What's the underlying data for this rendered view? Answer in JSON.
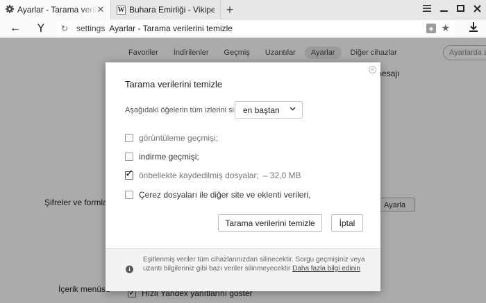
{
  "browser": {
    "tabs": [
      {
        "title": "Ayarlar - Tarama verilerini temizle",
        "icon": "gear-icon",
        "active": true
      },
      {
        "title": "Buhara Emirliği - Vikipedi",
        "icon": "wikipedia-icon",
        "active": false
      }
    ],
    "new_tab_glyph": "+",
    "address": {
      "scheme": "settings",
      "title": "Ayarlar - Tarama verilerini temizle"
    }
  },
  "settings": {
    "nav": [
      "Favoriler",
      "İndirilenler",
      "Geçmiş",
      "Uzantılar",
      "Ayarlar",
      "Diğer cihazlar"
    ],
    "selected_nav": "Ayarlar",
    "search_placeholder": "Ayarlarda ara",
    "passwords_label": "Şifreler ve formlar",
    "context_menu_label": "İçerik menüsü",
    "settings_button": "Ayarla",
    "context_option": "Hızlı Yandex yanıtlarını göster",
    "partial_text": "mesajı"
  },
  "dialog": {
    "title": "Tarama verilerini temizle",
    "range_label": "Aşağıdaki öğelerin tüm izlerini sil:",
    "range_value": "en baştan",
    "options": [
      {
        "label": "görüntüleme geçmişi;",
        "checked": false,
        "muted": true
      },
      {
        "label": "indirme geçmişi;",
        "checked": false,
        "muted": false
      },
      {
        "label": "önbellekte kaydedilmiş dosyalar;",
        "checked": true,
        "muted": true,
        "size": "–  32,0 MB"
      },
      {
        "label": "Çerez dosyaları ile diğer site ve eklenti verileri,",
        "checked": false,
        "muted": false
      }
    ],
    "clear_button": "Tarama verilerini temizle",
    "cancel_button": "İptal",
    "footer_text": "Eşitlenmiş veriler tüm cihazlarınızdan silinecektir. Sorgu geçmişiniz veya uzantı bilgileriniz gibi bazı veriler silinmeyecektir ",
    "footer_link": "Daha fazla bilgi edinin"
  }
}
